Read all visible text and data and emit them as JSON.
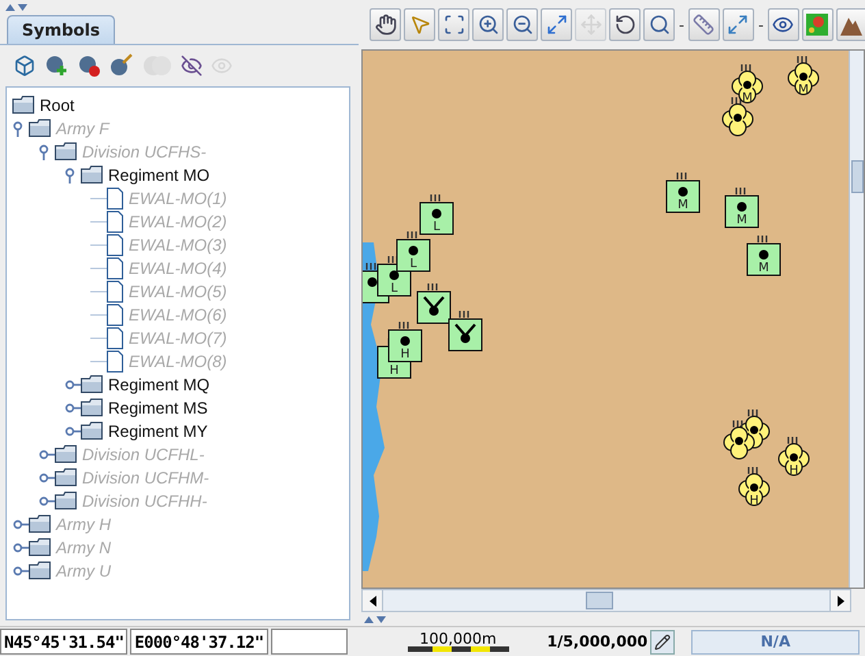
{
  "panel": {
    "tab": {
      "label": "Symbols",
      "selected": true
    },
    "tools": [
      {
        "kind": "cube",
        "disabled": false
      },
      {
        "kind": "add",
        "disabled": false
      },
      {
        "kind": "remove",
        "disabled": false
      },
      {
        "kind": "edit",
        "disabled": false
      },
      {
        "kind": "merge",
        "disabled": true
      },
      {
        "kind": "hide",
        "disabled": false
      },
      {
        "kind": "show",
        "disabled": true
      }
    ]
  },
  "tree": {
    "label": "Root",
    "disabled": false,
    "kind": "folder",
    "children": [
      {
        "label": "Army F",
        "disabled": true,
        "expanded": true,
        "kind": "folder",
        "children": [
          {
            "label": "Division UCFHS-",
            "disabled": true,
            "expanded": true,
            "kind": "folder",
            "children": [
              {
                "label": "Regiment MO",
                "disabled": false,
                "expanded": true,
                "kind": "folder",
                "children": [
                  {
                    "label": "EWAL-MO(1)",
                    "disabled": true,
                    "kind": "file"
                  },
                  {
                    "label": "EWAL-MO(2)",
                    "disabled": true,
                    "kind": "file"
                  },
                  {
                    "label": "EWAL-MO(3)",
                    "disabled": true,
                    "kind": "file"
                  },
                  {
                    "label": "EWAL-MO(4)",
                    "disabled": true,
                    "kind": "file"
                  },
                  {
                    "label": "EWAL-MO(5)",
                    "disabled": true,
                    "kind": "file"
                  },
                  {
                    "label": "EWAL-MO(6)",
                    "disabled": true,
                    "kind": "file"
                  },
                  {
                    "label": "EWAL-MO(7)",
                    "disabled": true,
                    "kind": "file"
                  },
                  {
                    "label": "EWAL-MO(8)",
                    "disabled": true,
                    "kind": "file"
                  }
                ]
              },
              {
                "label": "Regiment MQ",
                "disabled": false,
                "expanded": false,
                "kind": "folder"
              },
              {
                "label": "Regiment MS",
                "disabled": false,
                "expanded": false,
                "kind": "folder"
              },
              {
                "label": "Regiment MY",
                "disabled": false,
                "expanded": false,
                "kind": "folder"
              }
            ]
          },
          {
            "label": "Division UCFHL-",
            "disabled": true,
            "expanded": false,
            "kind": "folder"
          },
          {
            "label": "Division UCFHM-",
            "disabled": true,
            "expanded": false,
            "kind": "folder"
          },
          {
            "label": "Division UCFHH-",
            "disabled": true,
            "expanded": false,
            "kind": "folder"
          }
        ]
      },
      {
        "label": "Army H",
        "disabled": true,
        "expanded": false,
        "kind": "folder"
      },
      {
        "label": "Army N",
        "disabled": true,
        "expanded": false,
        "kind": "folder"
      },
      {
        "label": "Army U",
        "disabled": true,
        "expanded": false,
        "kind": "folder"
      }
    ]
  },
  "map_toolbar": [
    {
      "kind": "hand",
      "disabled": false
    },
    {
      "kind": "pointer",
      "disabled": false
    },
    {
      "kind": "zoom-box",
      "disabled": false
    },
    {
      "kind": "zoom-in",
      "disabled": false
    },
    {
      "kind": "zoom-out",
      "disabled": false
    },
    {
      "kind": "fit",
      "disabled": false
    },
    {
      "kind": "move",
      "disabled": true
    },
    {
      "kind": "rotate",
      "disabled": false
    },
    {
      "kind": "magnify",
      "disabled": false
    },
    {
      "kind": "separator",
      "text": "-"
    },
    {
      "kind": "ruler",
      "disabled": false
    },
    {
      "kind": "expand",
      "disabled": false
    },
    {
      "kind": "separator",
      "text": "-"
    },
    {
      "kind": "eye",
      "disabled": false
    },
    {
      "kind": "terrain",
      "disabled": false
    },
    {
      "kind": "relief",
      "disabled": false
    }
  ],
  "map": {
    "symbols": [
      {
        "kind": "square-dot"
      },
      {
        "kind": "square-dot",
        "letter": "L"
      },
      {
        "kind": "square-dot",
        "letter": "L"
      },
      {
        "kind": "square-dot",
        "letter": "L"
      },
      {
        "kind": "square-fork"
      },
      {
        "kind": "square-fork"
      },
      {
        "kind": "square-dot",
        "letter": "H"
      },
      {
        "kind": "square-dot",
        "letter": "H"
      },
      {
        "kind": "square-dot",
        "letter": "M"
      },
      {
        "kind": "square-dot",
        "letter": "M"
      },
      {
        "kind": "square-dot",
        "letter": "M"
      },
      {
        "kind": "clover"
      },
      {
        "kind": "clover",
        "letter": "M"
      },
      {
        "kind": "clover",
        "letter": "M"
      },
      {
        "kind": "clover"
      },
      {
        "kind": "clover"
      },
      {
        "kind": "clover",
        "letter": "H"
      },
      {
        "kind": "clover",
        "letter": "H"
      }
    ]
  },
  "status_bar": {
    "latitude": "N45°45'31.54\"",
    "longitude": "E000°48'37.12\"",
    "scale_label": "100,000m",
    "scale": "1/5,000,000",
    "projection": "N/A"
  }
}
